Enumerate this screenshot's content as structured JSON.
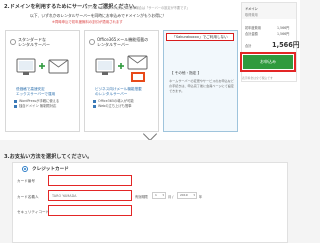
{
  "section2": {
    "title": "2.ドメインを利用するためにサーバーをご選択ください。",
    "subtitle": "※ドメイン単体での申込をご希望の場合は「サーバーの設定が不要です」",
    "caption1": "以下、いずれかのレンタルサーバーを同時にお申込みでドメインがもうお得に！",
    "caption2": "※同時申込で初年度無料の割引が適用されます",
    "options": [
      {
        "title": "スタンダードな\nレンタルサーバー",
        "desc": "低価格で高速安定\nエックスサーバーで運用",
        "checks": [
          "WordPressが手軽に使える",
          "独自ドメイン 無制限対応"
        ],
        "selected": false
      },
      {
        "title": "Office365メール機能搭載の\nレンタルサーバー",
        "desc": "ビジネス向けメール機能搭載\nのレンタルサーバー",
        "checks": [
          "Office365の導入が可能",
          "Webの立ち上げも簡単"
        ],
        "selected": false
      },
      {
        "badge": "「Sakuraboxxx」でご利用しない",
        "q_title": "【 その他・指定 】",
        "text": "ネームサーバーの変更やサービスのお申込などの手続きは、申込完了後に会員ページにて設定できます。"
      }
    ]
  },
  "sidebar": {
    "domain_label": "ドメイン",
    "domain_sub": "取得費用",
    "row1_label": "初年度費用",
    "row1_value": "1,566円",
    "row2_label": "合計金額",
    "row2_value": "1,566円",
    "total_label": "合計",
    "total_price": "1,566円",
    "apply_label": "お申込み",
    "note": "表示料金は全て税込です"
  },
  "section3": {
    "title": "3.お支払い方法を選択してください。",
    "method_label": "クレジットカード",
    "card_number_label": "カード番号",
    "card_name_label": "カード名義人",
    "security_label": "セキュリティコード",
    "card_number_placeholder": "",
    "card_name_placeholder": "TARO YAMADA",
    "security_placeholder": "",
    "expiry_label": "有効期限",
    "month_value": "1",
    "month_unit": "月 /",
    "year_value": "2019",
    "year_unit": "年"
  }
}
